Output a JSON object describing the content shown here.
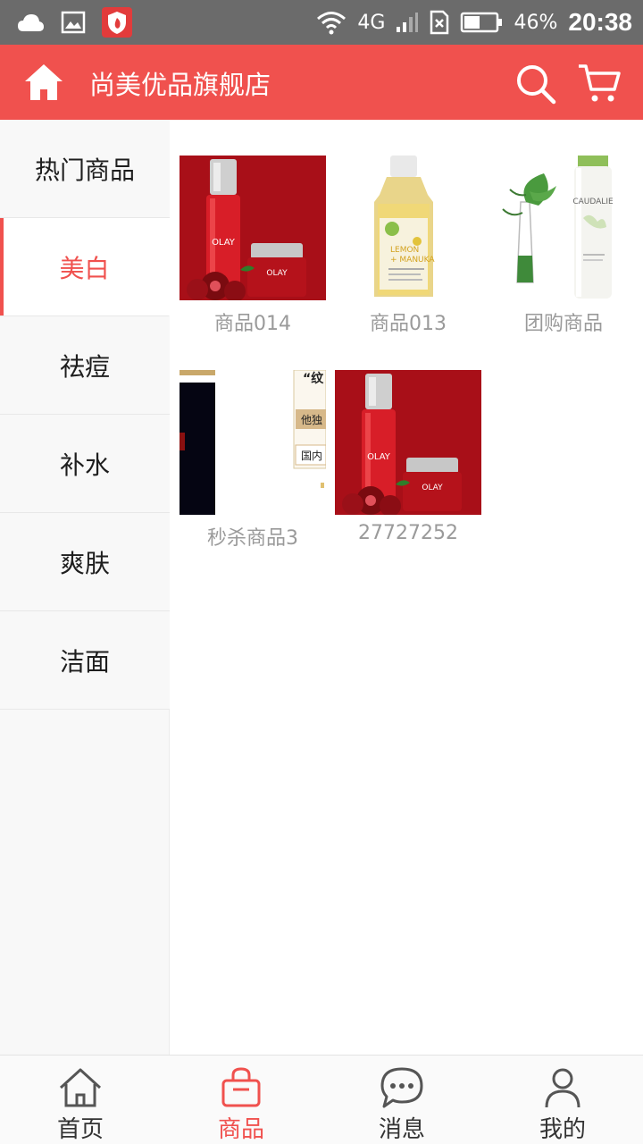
{
  "status_bar": {
    "network": "4G",
    "battery": "46%",
    "time": "20:38"
  },
  "header": {
    "title": "尚美优品旗舰店"
  },
  "sidebar": {
    "items": [
      {
        "label": "热门商品"
      },
      {
        "label": "美白"
      },
      {
        "label": "祛痘"
      },
      {
        "label": "补水"
      },
      {
        "label": "爽肤"
      },
      {
        "label": "洁面"
      }
    ],
    "selected": "美白"
  },
  "products": [
    {
      "name": "商品014",
      "image": "olay-red-set"
    },
    {
      "name": "商品013",
      "image": "lemon-manuka-bottle"
    },
    {
      "name": "团购商品",
      "image": "caudalie-spray"
    },
    {
      "name": "秒杀商品3",
      "image": "promo-banner-crop"
    },
    {
      "name": "27727252",
      "image": "olay-red-set"
    }
  ],
  "bottom_nav": {
    "tabs": [
      {
        "label": "首页",
        "icon": "home-outline-icon"
      },
      {
        "label": "商品",
        "icon": "shopping-bag-icon"
      },
      {
        "label": "消息",
        "icon": "chat-bubble-icon"
      },
      {
        "label": "我的",
        "icon": "user-icon"
      }
    ],
    "active": "商品"
  },
  "colors": {
    "accent": "#f0514e",
    "status_bar": "#6b6b6b"
  }
}
